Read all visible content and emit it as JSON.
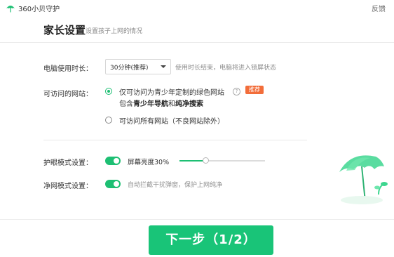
{
  "app": {
    "title": "360小贝守护",
    "feedback_label": "反馈",
    "logo_icon": "umbrella-icon"
  },
  "header": {
    "title": "家长设置",
    "subtitle": "设置孩子上网的情况"
  },
  "usage_time": {
    "label": "电脑使用时长：",
    "selected": "30分钟(推荐)",
    "hint": "使用时长结束，电脑将进入锁屏状态"
  },
  "websites": {
    "label": "可访问的网站：",
    "options": [
      {
        "line1": "仅可访问为青少年定制的绿色网站",
        "line2_prefix": "包含",
        "line2_bold": "青少年导航",
        "line2_mid": "和",
        "line2_bold2": "纯净搜索",
        "selected": true,
        "badge": "推荐"
      },
      {
        "line1": "可访问所有网站（不良网站除外）",
        "selected": false
      }
    ]
  },
  "eye_care": {
    "label": "护眼模式设置：",
    "enabled": true,
    "brightness_label": "屏幕亮度30%",
    "brightness": 0.3
  },
  "net_clean": {
    "label": "净网模式设置：",
    "enabled": true,
    "hint": "自动拦截干扰弹窗，保护上网纯净"
  },
  "footer": {
    "next_label": "下一步（1/2）"
  },
  "colors": {
    "accent": "#1dbf73",
    "button": "#19c478",
    "badge": "#f26d3a"
  }
}
